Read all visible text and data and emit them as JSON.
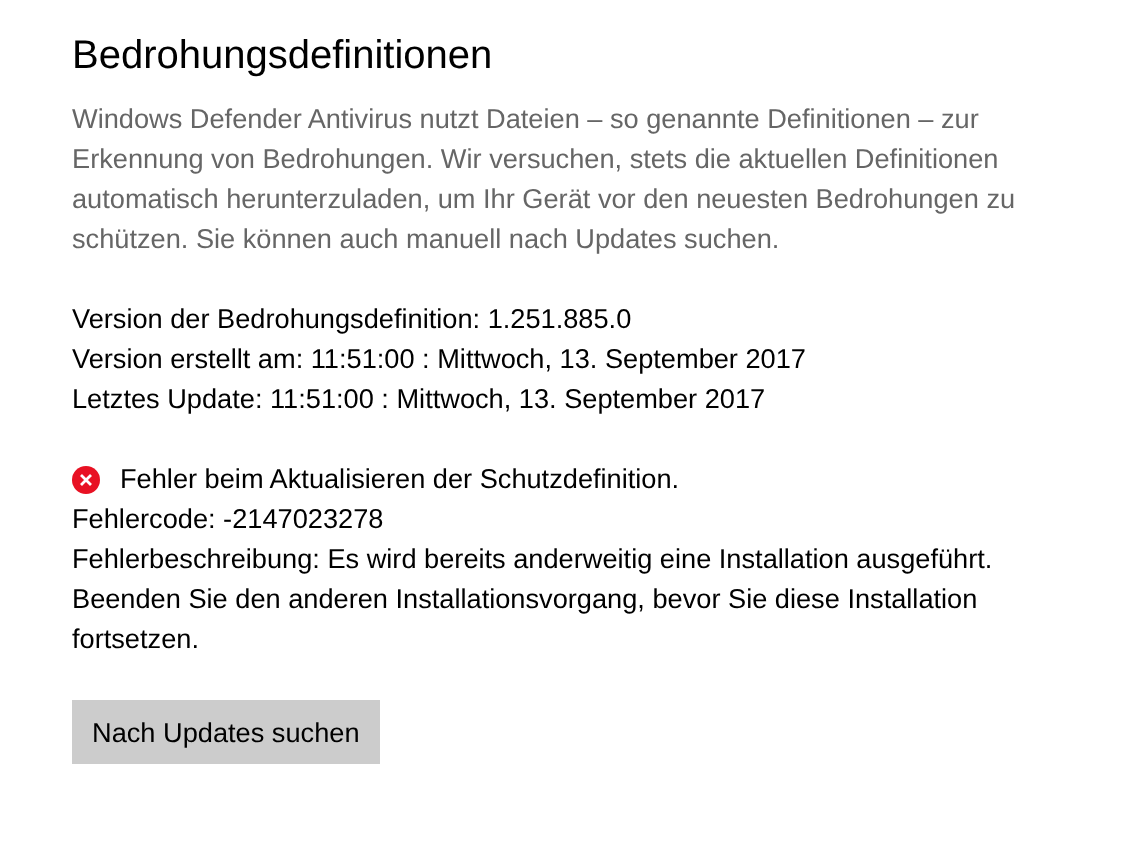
{
  "title": "Bedrohungsdefinitionen",
  "description": "Windows Defender Antivirus nutzt Dateien – so genannte Definitionen – zur Erkennung von Bedrohungen. Wir versuchen, stets die aktuellen Definitionen automatisch herunterzuladen, um Ihr Gerät vor den neuesten Bedrohungen zu schützen. Sie können auch manuell nach Updates suchen.",
  "info_lines": [
    "Version der Bedrohungsdefinition: 1.251.885.0",
    "Version erstellt am: 11:51:00 : Mittwoch, 13. September 2017",
    "Letztes Update: 11:51:00 : Mittwoch, 13. September 2017"
  ],
  "status": {
    "kind": "error",
    "message": "Fehler beim Aktualisieren der Schutzdefinition."
  },
  "error_lines": [
    "Fehlercode: -2147023278",
    "Fehlerbeschreibung: Es wird bereits anderweitig eine Installation ausgeführt. Beenden Sie den anderen Installationsvorgang, bevor Sie diese Installation fortsetzen."
  ],
  "button": "Nach Updates suchen"
}
